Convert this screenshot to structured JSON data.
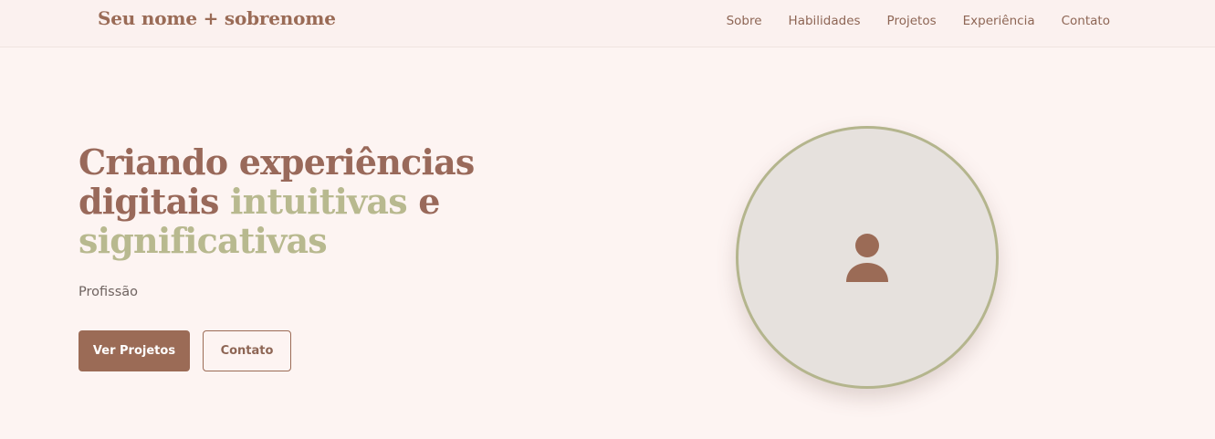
{
  "header": {
    "brand": "Seu nome + sobrenome",
    "nav": [
      "Sobre",
      "Habilidades",
      "Projetos",
      "Experiência",
      "Contato"
    ]
  },
  "hero": {
    "title_part1": "Criando experiências digitais ",
    "title_accent1": "intuitivas",
    "title_part2": " e ",
    "title_accent2": "significativas",
    "profession": "Profissão",
    "buttons": {
      "primary": "Ver Projetos",
      "secondary": "Contato"
    },
    "avatar_icon": "user-icon"
  },
  "colors": {
    "primary": "#9b6b56",
    "accent": "#b8b98f",
    "background": "#fdf4f2",
    "avatar_bg": "#e6e1dd"
  }
}
